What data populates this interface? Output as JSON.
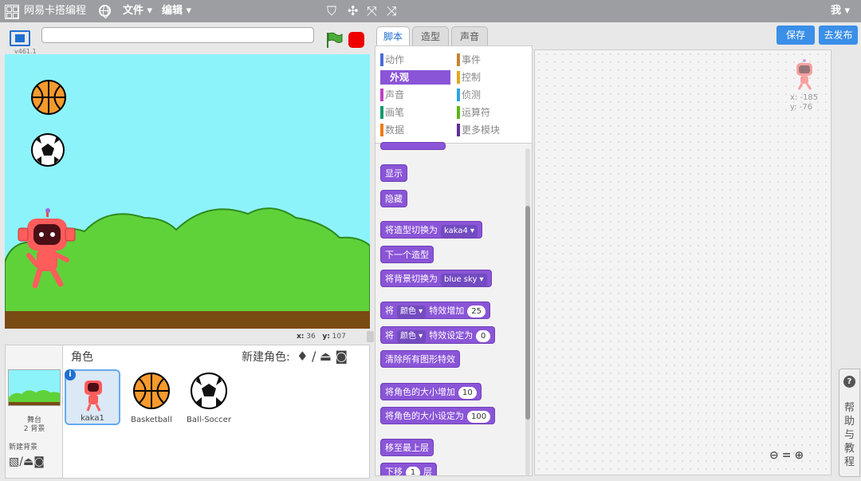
{
  "menubar": {
    "app_title": "网易卡搭编程",
    "file_menu": "文件 ▾",
    "edit_menu": "编辑 ▾",
    "user_menu": "我 ▾",
    "icons": [
      "stamp-icon",
      "cut-icon",
      "grow-icon",
      "shrink-icon"
    ]
  },
  "stage": {
    "version": "v461.1",
    "project_title": "",
    "mouse_x_label": "x:",
    "mouse_x": "36",
    "mouse_y_label": "y:",
    "mouse_y": "107"
  },
  "sprites": {
    "header": "角色",
    "new_sprite_label": "新建角色:",
    "stage_label": "舞台",
    "stage_backdrops": "2 背景",
    "new_backdrop_label": "新建背景",
    "items": [
      {
        "name": "kaka1",
        "selected": true
      },
      {
        "name": "Basketball",
        "selected": false
      },
      {
        "name": "Ball-Soccer",
        "selected": false
      }
    ]
  },
  "tabs": {
    "scripts": "脚本",
    "costumes": "造型",
    "sounds": "声音"
  },
  "actions": {
    "save": "保存",
    "publish": "去发布"
  },
  "categories": [
    {
      "label": "动作",
      "color": "#4a6cd4"
    },
    {
      "label": "事件",
      "color": "#c88330"
    },
    {
      "label": "外观",
      "color": "#8a55d7"
    },
    {
      "label": "控制",
      "color": "#e1a91a"
    },
    {
      "label": "声音",
      "color": "#bb42c3"
    },
    {
      "label": "侦测",
      "color": "#2ca5e2"
    },
    {
      "label": "画笔",
      "color": "#0e9a6c"
    },
    {
      "label": "运算符",
      "color": "#5cb712"
    },
    {
      "label": "数据",
      "color": "#ee7d16"
    },
    {
      "label": "更多模块",
      "color": "#632d99"
    }
  ],
  "blocks": {
    "show": "显示",
    "hide": "隐藏",
    "switch_costume": "将造型切换为",
    "costume_value": "kaka4",
    "next_costume": "下一个造型",
    "switch_backdrop": "将背景切换为",
    "backdrop_value": "blue sky",
    "change_effect_prefix": "将",
    "effect_value": "颜色",
    "change_effect_suffix": "特效增加",
    "change_effect_amount": "25",
    "set_effect_prefix": "将",
    "set_effect_value": "颜色",
    "set_effect_suffix": "特效设定为",
    "set_effect_amount": "0",
    "clear_effects": "清除所有图形特效",
    "change_size": "将角色的大小增加",
    "change_size_amount": "10",
    "set_size": "将角色的大小设定为",
    "set_size_amount": "100",
    "go_front": "移至最上层",
    "go_back_prefix": "下移",
    "go_back_amount": "1",
    "go_back_suffix": "层"
  },
  "script_area": {
    "sprite_x": "x: -185",
    "sprite_y": "y: -76"
  },
  "help": {
    "label": "帮助与教程"
  },
  "colors": {
    "accent": "#1f6fd1",
    "looks": "#8a55d7",
    "sky": "#8df3fb",
    "grass": "#5fd23a",
    "ground": "#7a4a13"
  }
}
